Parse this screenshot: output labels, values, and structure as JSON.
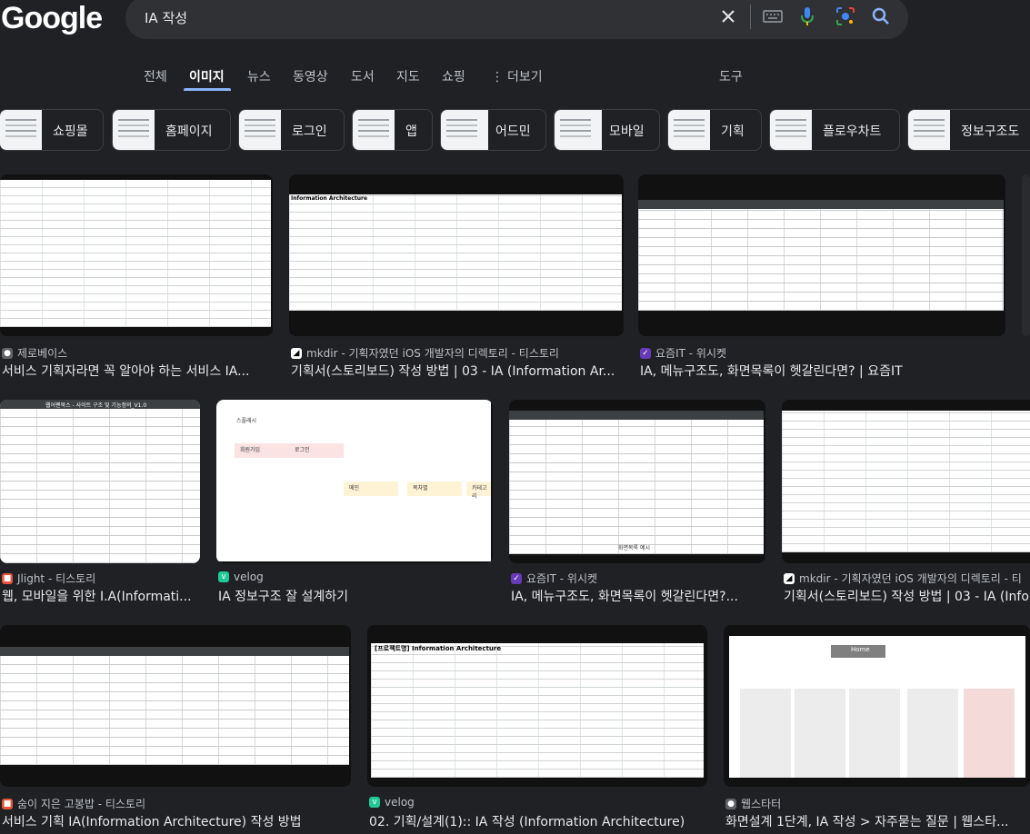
{
  "logo": "Google",
  "search": {
    "query": "IA 작성"
  },
  "tabs": [
    {
      "label": "전체"
    },
    {
      "label": "이미지"
    },
    {
      "label": "뉴스"
    },
    {
      "label": "동영상"
    },
    {
      "label": "도서"
    },
    {
      "label": "지도"
    },
    {
      "label": "쇼핑"
    },
    {
      "label": "더보기"
    },
    {
      "label": "도구"
    }
  ],
  "chips": [
    {
      "label": "쇼핑몰"
    },
    {
      "label": "홈페이지"
    },
    {
      "label": "로그인"
    },
    {
      "label": "앱"
    },
    {
      "label": "어드민"
    },
    {
      "label": "모바일"
    },
    {
      "label": "기획"
    },
    {
      "label": "플로우차트"
    },
    {
      "label": "정보구조도"
    }
  ],
  "results": [
    {
      "source": "제로베이스",
      "title": "서비스 기획자라면 꼭 알아야 하는 서비스 IA..."
    },
    {
      "source": "mkdir - 기획자였던 iOS 개발자의 디렉토리 - 티스토리",
      "title": "기획서(스토리보드) 작성 방법 | 03 - IA (Information Ar..."
    },
    {
      "source": "요즘IT - 위시켓",
      "title": "IA, 메뉴구조도, 화면목록이 헷갈린다면? | 요즘IT"
    },
    {
      "source": "Jlight - 티스토리",
      "title": "웹, 모바일을 위한 I.A(Informati..."
    },
    {
      "source": "velog",
      "title": "IA 정보구조 잘 설계하기"
    },
    {
      "source": "요즘IT - 위시켓",
      "title": "IA, 메뉴구조도, 화면목록이 헷갈린다면?..."
    },
    {
      "source": "mkdir - 기획자였던 iOS 개발자의 디렉토리 - 티",
      "title": "기획서(스토리보드) 작성 방법 | 03 - IA (Info"
    },
    {
      "source": "숨이 지은 고봉밥 - 티스토리",
      "title": "서비스 기획 IA(Information Architecture) 작성 방법"
    },
    {
      "source": "velog",
      "title": "02. 기획/설계(1):: IA 작성 (Information Architecture)"
    },
    {
      "source": "웹스타터",
      "title": "화면설계 1단계, IA 작성 > 자주묻는 질문 | 웹스타..."
    }
  ],
  "image_text": {
    "r1c2": "Information Architecture",
    "r2c1": "웹어펜북스 - 사이트 구조 및 기능정의_V1.0",
    "r2c2_a": "스플래시",
    "r2c2_b": "회원가입",
    "r2c2_c": "로그인",
    "r2c2_d": "메인",
    "r2c2_e": "목차별",
    "r2c2_f": "카테고리",
    "r2c3": "화면목록 예시",
    "r3c2": "[프로젝트명] Information Architecture",
    "r3c3": "Home"
  },
  "colors": {
    "background": "#202124",
    "searchbox": "#303134",
    "accent": "#8ab4f8",
    "text": "#e8eaed",
    "muted": "#bdc1c6"
  }
}
